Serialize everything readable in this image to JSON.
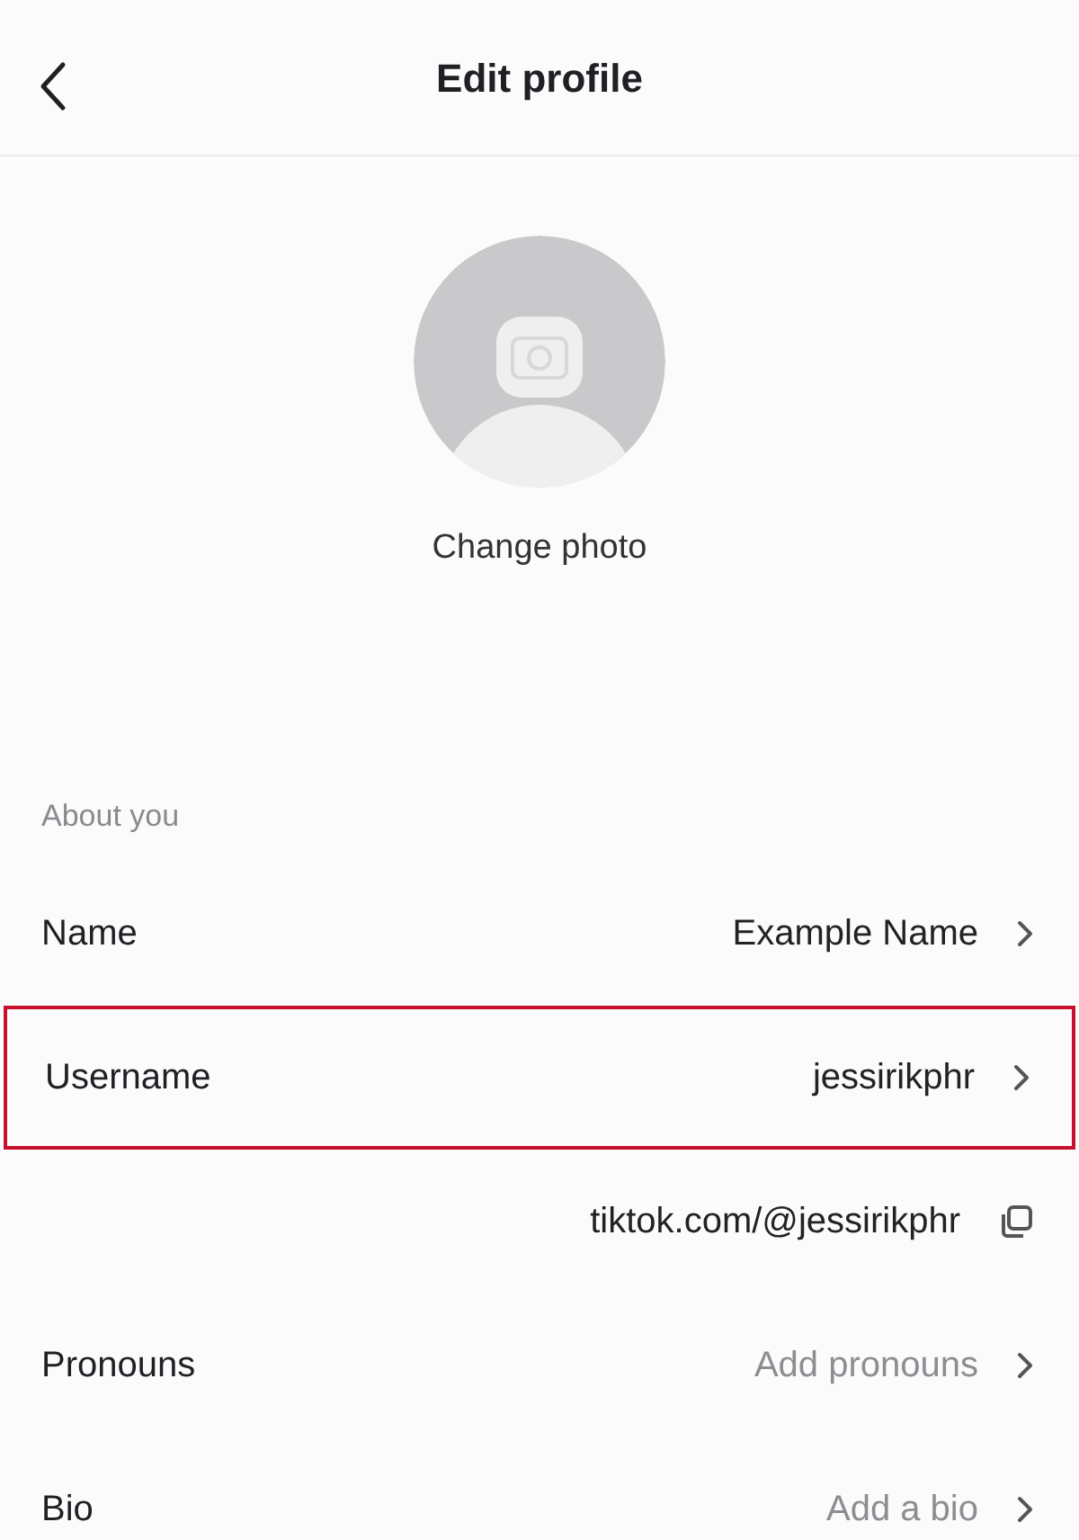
{
  "header": {
    "title": "Edit profile"
  },
  "photo": {
    "action": "Change photo"
  },
  "section": {
    "title": "About you"
  },
  "rows": [
    {
      "kind": "field",
      "label": "Name",
      "value": "Example Name",
      "highlighted": false
    },
    {
      "kind": "field",
      "label": "Username",
      "value": "jessirikphr",
      "highlighted": true
    },
    {
      "kind": "link",
      "value": "tiktok.com/@jessirikphr"
    },
    {
      "kind": "field",
      "label": "Pronouns",
      "placeholder": "Add pronouns",
      "highlighted": false
    },
    {
      "kind": "field",
      "label": "Bio",
      "placeholder": "Add a bio",
      "highlighted": false
    }
  ]
}
